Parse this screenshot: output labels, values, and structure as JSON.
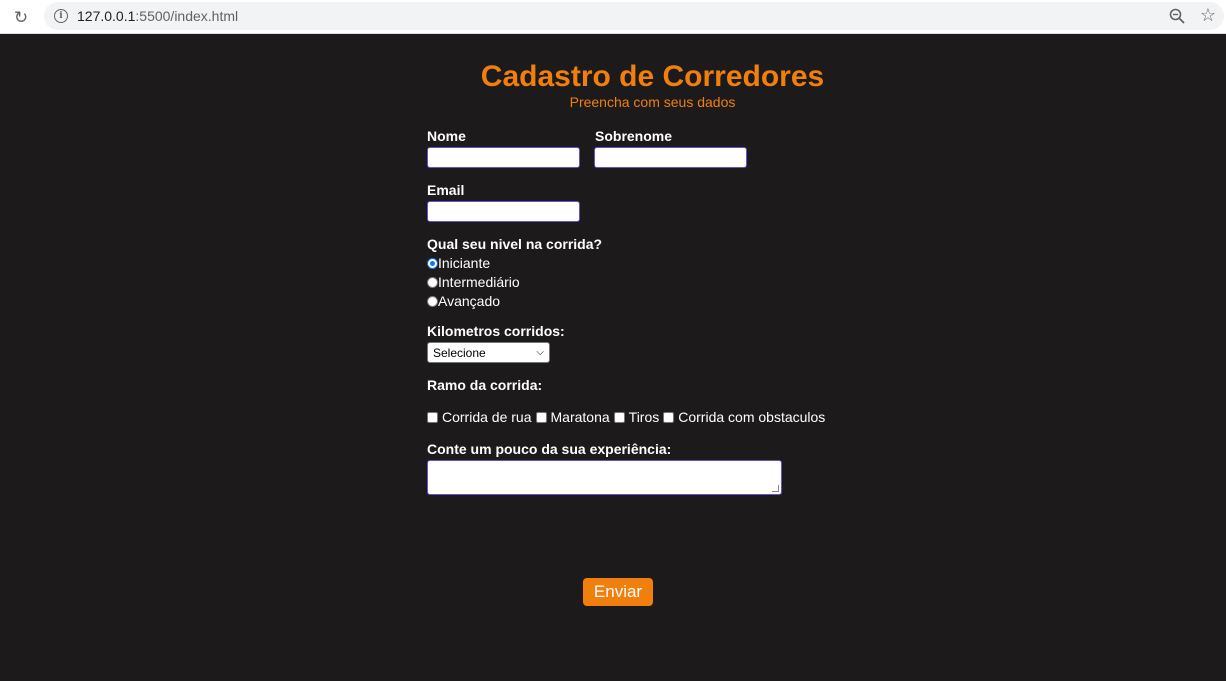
{
  "browser": {
    "url_host": "127.0.0.1",
    "url_path": ":5500/index.html"
  },
  "page": {
    "title": "Cadastro de Corredores",
    "subtitle": "Preencha com seus dados"
  },
  "form": {
    "nome_label": "Nome",
    "nome_value": "",
    "sobrenome_label": "Sobrenome",
    "sobrenome_value": "",
    "email_label": "Email",
    "email_value": "",
    "nivel_label": "Qual seu nivel na corrida?",
    "nivel_options": [
      "Iniciante",
      "Intermediário",
      "Avançado"
    ],
    "nivel_selected": "Iniciante",
    "km_label": "Kilometros corridos:",
    "km_selected": "Selecione",
    "ramo_label": "Ramo da corrida:",
    "ramo_options": [
      "Corrida de rua",
      "Maratona",
      "Tiros",
      "Corrida com obstaculos"
    ],
    "experiencia_label": "Conte um pouco da sua experiência:",
    "experiencia_value": "",
    "submit_label": "Enviar"
  },
  "colors": {
    "accent": "#f07f0d",
    "background": "#1c1a1b"
  }
}
